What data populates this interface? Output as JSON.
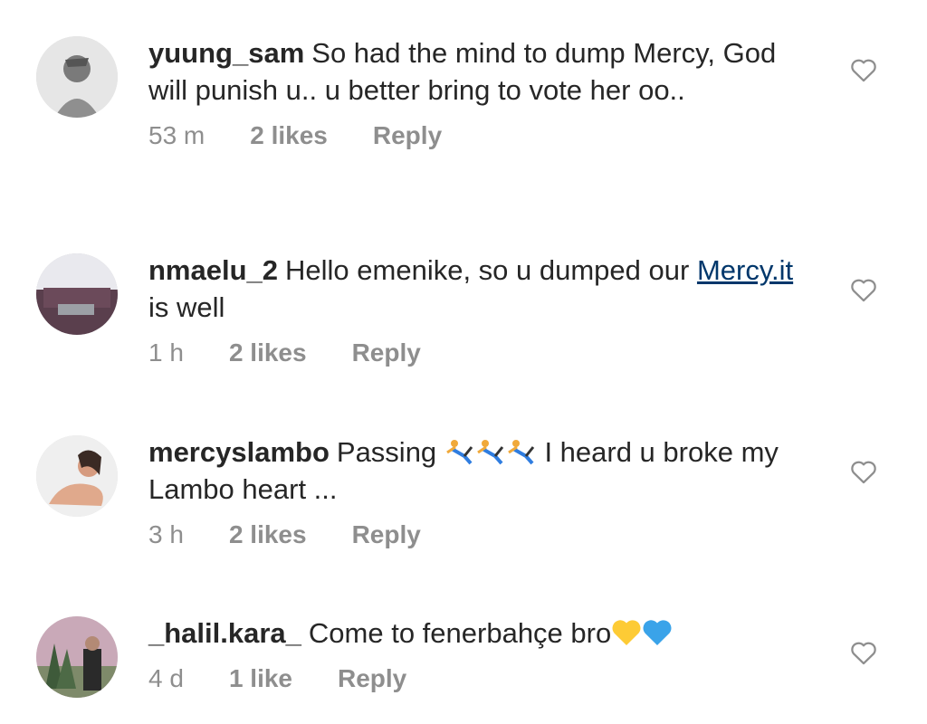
{
  "comments": [
    {
      "username": "yuung_sam",
      "text": "So had the mind to dump Mercy, God will punish u.. u better bring to vote her oo..",
      "time": "53 m",
      "likes": "2 likes",
      "reply": "Reply",
      "avatar_icon": "user-avatar-sketch",
      "like_icon": "heart-outline-icon"
    },
    {
      "username": "nmaelu_2",
      "text_before": "Hello emenike, so u dumped our",
      "link": "Mercy.it",
      "text_after": "is well",
      "time": "1 h",
      "likes": "2 likes",
      "reply": "Reply",
      "avatar_icon": "user-avatar-room",
      "like_icon": "heart-outline-icon"
    },
    {
      "username": "mercyslambo",
      "text_before": "Passing",
      "emoji": [
        "person-cartwheeling",
        "person-cartwheeling",
        "person-cartwheeling"
      ],
      "text_after": "I heard u broke my Lambo heart ...",
      "time": "3 h",
      "likes": "2 likes",
      "reply": "Reply",
      "avatar_icon": "user-avatar-photo",
      "like_icon": "heart-outline-icon"
    },
    {
      "username": "_halil.kara_",
      "text": "Come to fenerbahçe bro",
      "emoji": [
        "yellow-heart",
        "blue-heart"
      ],
      "time": "4 d",
      "likes": "1 like",
      "reply": "Reply",
      "avatar_icon": "user-avatar-outdoor",
      "like_icon": "heart-outline-icon"
    }
  ],
  "colors": {
    "text": "#262626",
    "meta": "#8e8e8e",
    "link": "#00376b",
    "yellow_heart": "#fdcb35",
    "blue_heart": "#3aa3e9"
  }
}
